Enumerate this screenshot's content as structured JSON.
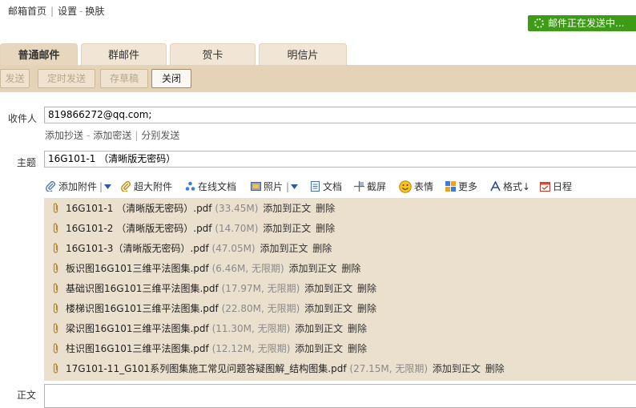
{
  "top_links": {
    "home": "邮箱首页",
    "settings": "设置",
    "skin": "换肤",
    "sep": "|",
    "dash": "-"
  },
  "sending_status": "邮件正在发送中...",
  "tabs": [
    {
      "label": "普通邮件",
      "active": true
    },
    {
      "label": "群邮件",
      "active": false
    },
    {
      "label": "贺卡",
      "active": false
    },
    {
      "label": "明信片",
      "active": false
    }
  ],
  "toolbar": {
    "send": "发送",
    "timed_send": "定时发送",
    "save_draft": "存草稿",
    "close": "关闭"
  },
  "recipient": {
    "label": "收件人",
    "value": "819866272@qq.com;"
  },
  "recipient_actions": {
    "cc": "添加抄送",
    "bcc": "添加密送",
    "separate": "分别发送",
    "dash": "-",
    "sep": "|"
  },
  "subject": {
    "label": "主题",
    "value": "16G101-1 （清晰版无密码）"
  },
  "attach_toolbar": {
    "add_attachment": "添加附件",
    "super_attachment": "超大附件",
    "online_doc": "在线文档",
    "photo": "照片",
    "doc": "文档",
    "screenshot": "截屏",
    "emoji": "表情",
    "more": "更多",
    "format": "格式↓",
    "schedule": "日程"
  },
  "attachments": [
    {
      "name": "16G101-1 （清晰版无密码）.pdf",
      "size": "(33.45M)",
      "add": "添加到正文",
      "del": "删除"
    },
    {
      "name": "16G101-2 （清晰版无密码）.pdf",
      "size": "(14.70M)",
      "add": "添加到正文",
      "del": "删除"
    },
    {
      "name": "16G101-3（清晰版无密码）.pdf",
      "size": "(47.05M)",
      "add": "添加到正文",
      "del": "删除"
    },
    {
      "name": "板识图16G101三维平法图集.pdf",
      "size": "(6.46M, 无限期)",
      "add": "添加到正文",
      "del": "删除"
    },
    {
      "name": "基础识图16G101三维平法图集.pdf",
      "size": "(17.97M, 无限期)",
      "add": "添加到正文",
      "del": "删除"
    },
    {
      "name": "楼梯识图16G101三维平法图集.pdf",
      "size": "(22.80M, 无限期)",
      "add": "添加到正文",
      "del": "删除"
    },
    {
      "name": "梁识图16G101三维平法图集.pdf",
      "size": "(11.30M, 无限期)",
      "add": "添加到正文",
      "del": "删除"
    },
    {
      "name": "柱识图16G101三维平法图集.pdf",
      "size": "(12.12M, 无限期)",
      "add": "添加到正文",
      "del": "删除"
    },
    {
      "name": "17G101-11_G101系列图集施工常见问题答疑图解_结构图集.pdf",
      "size": "(27.15M, 无限期)",
      "add": "添加到正文",
      "del": "删除"
    }
  ],
  "body_label": "正文",
  "colors": {
    "accent_green": "#3d9b18",
    "band": "#e4d3b6",
    "panel": "#ebdfce"
  }
}
